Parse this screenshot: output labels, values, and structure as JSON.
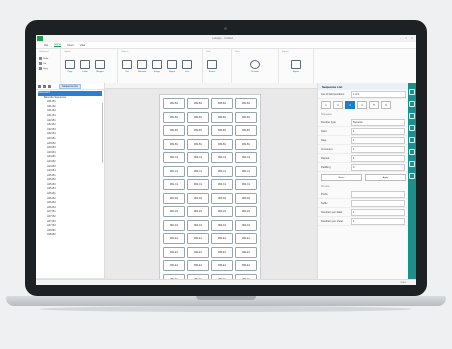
{
  "window": {
    "title": "Labeljoy - Untitled",
    "controls": [
      "–",
      "□",
      "✕"
    ]
  },
  "menu": [
    "File",
    "Home",
    "Insert",
    "View"
  ],
  "ribbon": {
    "groups": [
      {
        "title": "Clipboard",
        "small": [
          "Paste",
          "Cut",
          "Copy"
        ]
      },
      {
        "title": "Layout",
        "buttons": [
          "Page",
          "Label",
          "Margins"
        ]
      },
      {
        "title": "Objects",
        "buttons": [
          "Text",
          "Barcode",
          "Image",
          "Shape",
          "Line"
        ]
      },
      {
        "title": "Data",
        "buttons": [
          "Source"
        ]
      },
      {
        "title": "Print",
        "buttons": [
          "Preview"
        ]
      },
      {
        "title": "Export",
        "buttons": [
          "Export"
        ]
      }
    ]
  },
  "tree": {
    "tab": "Sequence list",
    "root": "Document",
    "group": "Barcode Sequence",
    "items": [
      "A01-B1",
      "A01-B2",
      "A01-B3",
      "A01-B4",
      "A02-B1",
      "A02-B2",
      "A02-B3",
      "A02-B4",
      "A03-B1",
      "A03-B2",
      "A03-B3",
      "A03-B4",
      "A04-B1",
      "A04-B2",
      "A04-B3",
      "A04-B4",
      "A05-B1",
      "A05-B2",
      "A05-B3",
      "A05-B4",
      "A06-B1",
      "A06-B2",
      "A06-B3",
      "A06-B4",
      "A07-B1",
      "A07-B2",
      "A07-B3",
      "A07-B4",
      "A08-B1",
      "A08-B2"
    ]
  },
  "labels": [
    [
      "4B1-B1",
      "4B2-B1",
      "4B3-B1",
      "4B4-B1"
    ],
    [
      "4B1-B1",
      "4B2-B1",
      "4B3-B1",
      "4B4-B1"
    ],
    [
      "4B1-B1",
      "4B2-B1",
      "4B3-B1",
      "4B4-B1"
    ],
    [
      "4B1-B1",
      "4B2-B1",
      "4B3-B1",
      "4B4-B1"
    ],
    [
      "4B1-C1",
      "4B2-C1",
      "4B3-C1",
      "4B4-C1"
    ],
    [
      "4B1-C1",
      "4B2-C1",
      "4B3-C1",
      "4B4-C1"
    ],
    [
      "4B1-C1",
      "4B2-C1",
      "4B3-C1",
      "4B4-C1"
    ],
    [
      "4B1-D1",
      "4B2-D1",
      "4B3-D1",
      "4B4-D1"
    ],
    [
      "4B1-D1",
      "4B2-D1",
      "4B3-D1",
      "4B4-D1"
    ],
    [
      "4B1-D1",
      "4B2-D1",
      "4B3-D1",
      "4B4-D1"
    ],
    [
      "4B1-E1",
      "4B2-E1",
      "4B3-E1",
      "4B4-E1"
    ],
    [
      "4B1-E1",
      "4B2-E1",
      "4B3-E1",
      "4B4-E1"
    ],
    [
      "4B1-E1",
      "4B2-E1",
      "4B3-E1",
      "4B4-E1"
    ],
    [
      "4B1-F1",
      "4B2-F1",
      "4B3-F1",
      "4B4-F1"
    ],
    [
      "4B1-F1",
      "4B2-F1",
      "4B3-F1",
      "4B4-F1"
    ]
  ],
  "properties": {
    "header": "Sequence List",
    "position_label": "List of field positions",
    "position_value": "1 of 1",
    "steps": [
      "1",
      "2",
      "3",
      "4",
      "5",
      "6"
    ],
    "section": "Sequence",
    "rows": [
      {
        "label": "Number type",
        "value": "Numeric"
      },
      {
        "label": "Start",
        "value": "1"
      },
      {
        "label": "Step",
        "value": "1"
      },
      {
        "label": "Increment",
        "value": "1"
      },
      {
        "label": "Repeat",
        "value": "1"
      },
      {
        "label": "Padding",
        "value": "0"
      }
    ],
    "buttons": [
      "Reset",
      "Apply"
    ],
    "section2": "Preview",
    "rows2": [
      {
        "label": "Prefix",
        "value": ""
      },
      {
        "label": "Suffix",
        "value": ""
      },
      {
        "label": "Numbers per label",
        "value": "1"
      },
      {
        "label": "Numbers per sheet",
        "value": "1"
      }
    ]
  },
  "status": "100%"
}
